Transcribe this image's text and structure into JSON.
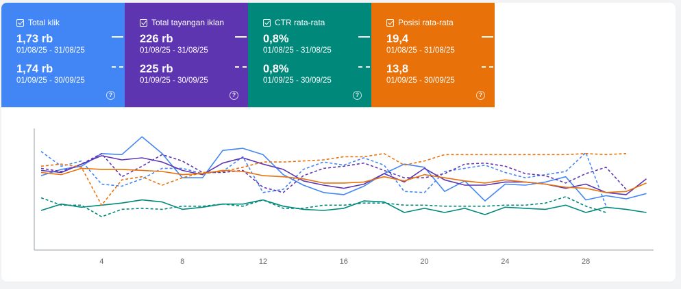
{
  "metrics": [
    {
      "key": "clicks",
      "label": "Total klik",
      "color": "#4285f4",
      "current_value": "1,73 rb",
      "current_range": "01/08/25 - 31/08/25",
      "previous_value": "1,74 rb",
      "previous_range": "01/09/25 - 30/09/25"
    },
    {
      "key": "impressions",
      "label": "Total tayangan iklan",
      "color": "#5e35b1",
      "current_value": "226 rb",
      "current_range": "01/08/25 - 31/08/25",
      "previous_value": "225 rb",
      "previous_range": "01/09/25 - 30/09/25"
    },
    {
      "key": "ctr",
      "label": "CTR rata-rata",
      "color": "#00897b",
      "current_value": "0,8%",
      "current_range": "01/08/25 - 31/08/25",
      "previous_value": "0,8%",
      "previous_range": "01/09/25 - 30/09/25"
    },
    {
      "key": "position",
      "label": "Posisi rata-rata",
      "color": "#e8710a",
      "current_value": "19,4",
      "current_range": "01/08/25 - 31/08/25",
      "previous_value": "13,8",
      "previous_range": "01/09/25 - 30/09/25"
    }
  ],
  "help_icon": "help-circle-icon",
  "help_glyph": "?",
  "chart_data": {
    "type": "line",
    "x": [
      1,
      2,
      3,
      4,
      5,
      6,
      7,
      8,
      9,
      10,
      11,
      12,
      13,
      14,
      15,
      16,
      17,
      18,
      19,
      20,
      21,
      22,
      23,
      24,
      25,
      26,
      27,
      28,
      29,
      30,
      31
    ],
    "xticks": [
      "4",
      "8",
      "12",
      "16",
      "20",
      "24",
      "28"
    ],
    "xtick_values": [
      4,
      8,
      12,
      16,
      20,
      24,
      28
    ],
    "ylim": [
      0,
      100
    ],
    "grid": false,
    "series": [
      {
        "metric": "clicks",
        "period": "current",
        "style": "solid",
        "color": "#4285f4",
        "values": [
          59,
          65,
          68,
          80,
          79,
          96,
          80,
          57,
          57,
          83,
          85,
          79,
          60,
          50,
          43,
          41,
          49,
          61,
          70,
          67,
          44,
          54,
          35,
          51,
          50,
          53,
          58,
          36,
          40,
          37,
          42
        ]
      },
      {
        "metric": "clicks",
        "period": "previous",
        "style": "dashed",
        "color": "#4285f4",
        "values": [
          82,
          68,
          73,
          51,
          49,
          56,
          66,
          66,
          61,
          63,
          77,
          43,
          46,
          65,
          72,
          69,
          76,
          69,
          44,
          43,
          63,
          66,
          69,
          62,
          57,
          60,
          63,
          81,
          30,
          null,
          null
        ]
      },
      {
        "metric": "impressions",
        "period": "current",
        "style": "solid",
        "color": "#5e35b1",
        "values": [
          64,
          62,
          70,
          78,
          74,
          76,
          72,
          64,
          60,
          71,
          76,
          70,
          65,
          54,
          50,
          47,
          51,
          61,
          53,
          66,
          55,
          50,
          50,
          53,
          53,
          51,
          47,
          51,
          43,
          41,
          56
        ]
      },
      {
        "metric": "impressions",
        "period": "previous",
        "style": "dashed",
        "color": "#5e35b1",
        "values": [
          66,
          63,
          70,
          80,
          58,
          68,
          79,
          73,
          62,
          62,
          64,
          48,
          43,
          59,
          66,
          68,
          71,
          64,
          57,
          57,
          61,
          70,
          71,
          68,
          61,
          59,
          52,
          61,
          67,
          46,
          null
        ]
      },
      {
        "metric": "ctr",
        "period": "current",
        "style": "solid",
        "color": "#00897b",
        "values": [
          26,
          32,
          29,
          31,
          33,
          36,
          34,
          27,
          29,
          32,
          32,
          36,
          30,
          27,
          26,
          28,
          35,
          34,
          24,
          28,
          24,
          28,
          22,
          29,
          28,
          27,
          31,
          24,
          29,
          27,
          24
        ]
      },
      {
        "metric": "ctr",
        "period": "previous",
        "style": "dashed",
        "color": "#00897b",
        "values": [
          38,
          31,
          31,
          20,
          27,
          28,
          27,
          30,
          30,
          32,
          30,
          36,
          28,
          28,
          31,
          31,
          33,
          33,
          31,
          31,
          30,
          30,
          30,
          31,
          31,
          33,
          39,
          30,
          24,
          null,
          null
        ]
      },
      {
        "metric": "position",
        "period": "current",
        "style": "solid",
        "color": "#e8710a",
        "values": [
          62,
          60,
          66,
          65,
          65,
          64,
          63,
          60,
          61,
          64,
          63,
          59,
          58,
          56,
          52,
          52,
          53,
          58,
          54,
          60,
          57,
          54,
          52,
          55,
          53,
          51,
          48,
          47,
          43,
          44,
          52
        ]
      },
      {
        "metric": "position",
        "period": "previous",
        "style": "dashed",
        "color": "#e8710a",
        "values": [
          68,
          70,
          67,
          31,
          55,
          58,
          50,
          57,
          62,
          63,
          67,
          72,
          72,
          73,
          74,
          77,
          77,
          80,
          69,
          73,
          79,
          79,
          79,
          79,
          79,
          79,
          79,
          80,
          79,
          80,
          null
        ]
      }
    ]
  }
}
